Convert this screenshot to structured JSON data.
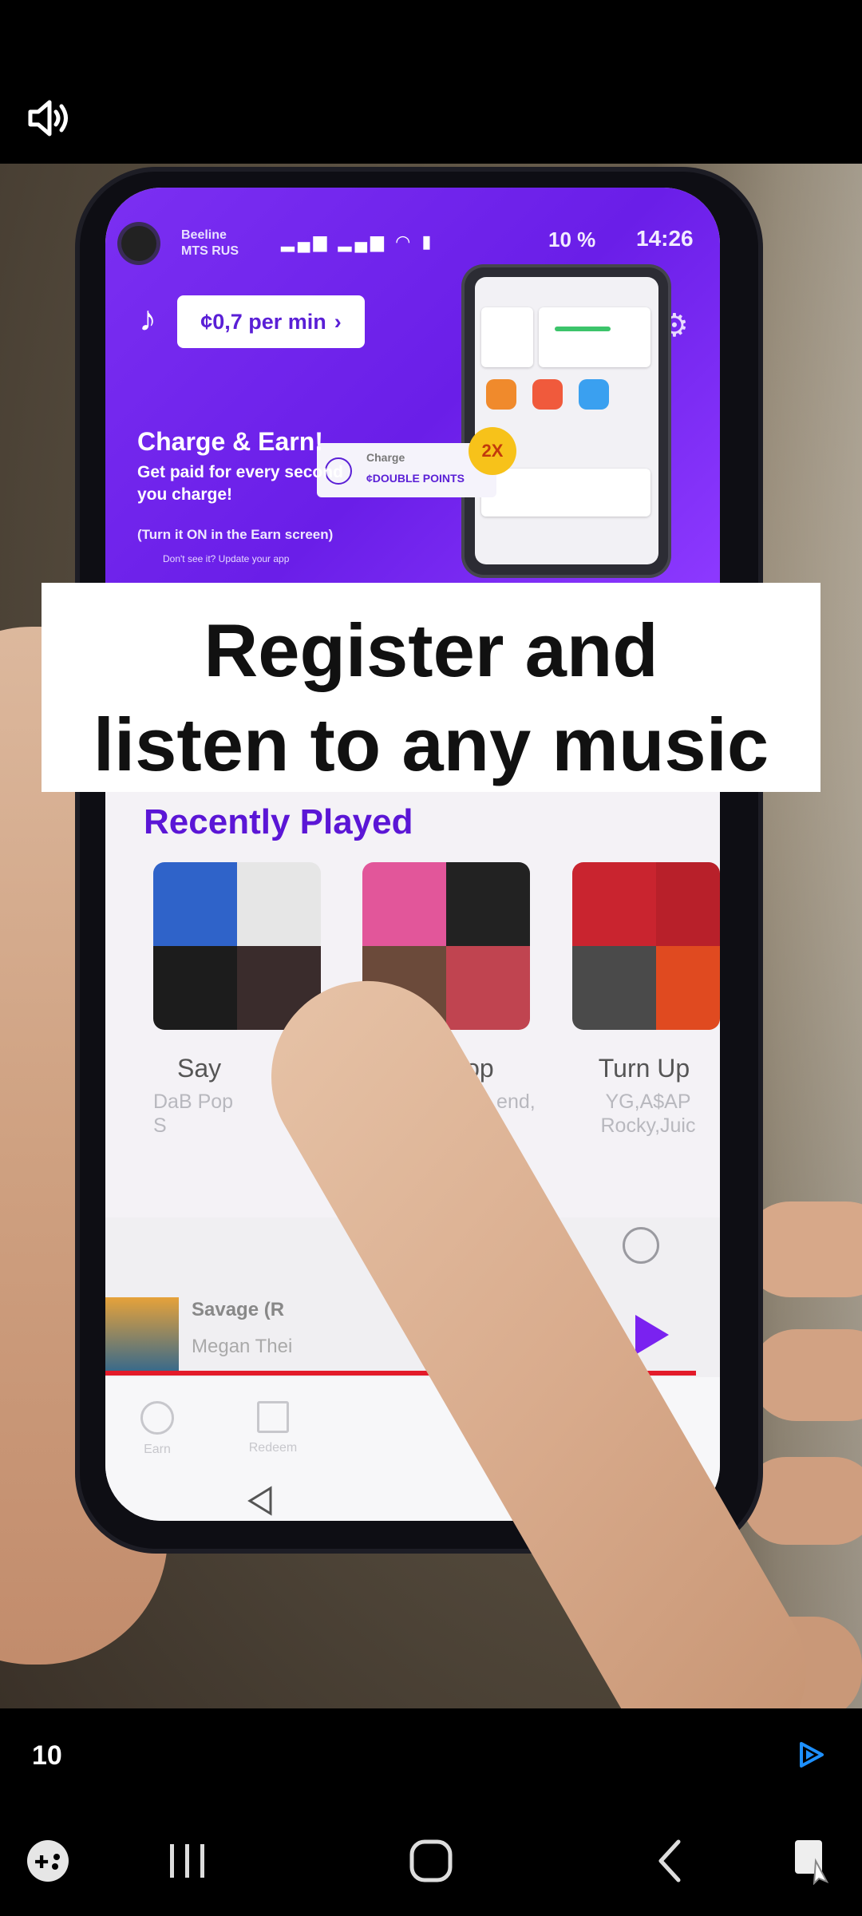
{
  "top_bar": {
    "mute_icon": "volume-icon"
  },
  "phone_screen": {
    "status": {
      "carrier_line1": "Beeline",
      "carrier_line2": "MTS RUS",
      "battery": "10 %",
      "time": "14:26"
    },
    "promo": {
      "rate": "¢0,7 per min",
      "title": "Charge & Earn!",
      "subtitle": "Get paid for every second you charge!",
      "hint": "(Turn it ON in the Earn screen)",
      "tiny": "Don't see it? Update your app",
      "charge_label": "Charge",
      "double_points": "¢DOUBLE POINTS",
      "bonus": "2X"
    },
    "recently_played": {
      "title": "Recently Played",
      "items": [
        {
          "label": "Say",
          "sub": "DaB Pop S"
        },
        {
          "label": "Top Pop",
          "sub": "ja Cat, The end, Billie"
        },
        {
          "label": "Turn Up",
          "sub": "YG,A$AP Rocky,Juic"
        }
      ]
    },
    "player": {
      "track": "Savage (R",
      "artist": "Megan Thei"
    },
    "nav": {
      "earn": "Earn",
      "redeem": "Redeem"
    }
  },
  "caption": {
    "line1": "Register and",
    "line2": "listen to any music"
  },
  "bottom": {
    "counter": "10"
  },
  "colors": {
    "promo_purple": "#6a1ee8",
    "title_purple": "#5b16d6",
    "progress_red": "#e31b2a",
    "ad_blue": "#1e90ff"
  }
}
